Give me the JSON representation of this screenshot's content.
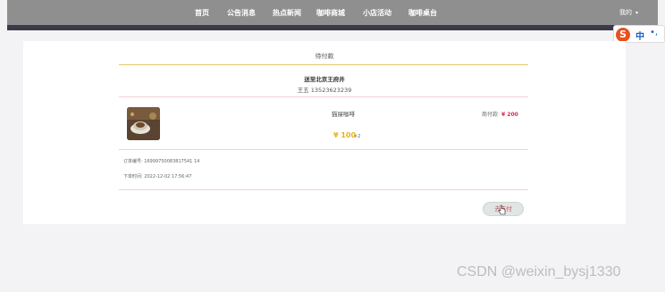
{
  "nav": {
    "items": [
      {
        "label": "首页",
        "name": "nav-home"
      },
      {
        "label": "公告消息",
        "name": "nav-notice"
      },
      {
        "label": "热点新闻",
        "name": "nav-news"
      },
      {
        "label": "咖啡商城",
        "name": "nav-shop"
      },
      {
        "label": "小店活动",
        "name": "nav-activity"
      },
      {
        "label": "咖啡桌台",
        "name": "nav-tables"
      }
    ],
    "me_label": "我的",
    "me_caret": "▾"
  },
  "ime": {
    "logo": "S",
    "text": "中",
    "dots": "•,"
  },
  "order": {
    "status_title": "待付款",
    "address": "送至北京王府井",
    "contact": "王五 13523623239",
    "product_name": "猫屎咖啡",
    "subtotal_label": "商付款",
    "subtotal_amount": "¥ 200",
    "price": "¥ 100",
    "quantity": "×2",
    "order_no_label": "订单编号:",
    "order_no": "16999750083817541 14",
    "order_time_label": "下单时间:",
    "order_time": "2022-12-02 17:56:47",
    "pay_button": "去支付"
  },
  "watermark": "CSDN @weixin_bysj1330"
}
